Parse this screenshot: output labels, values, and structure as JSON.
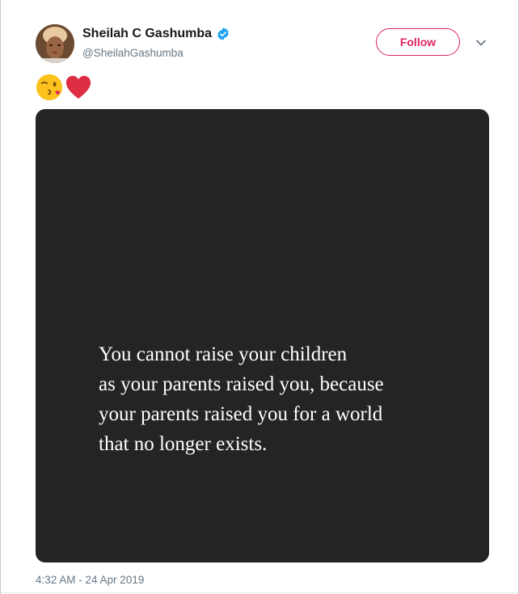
{
  "author": {
    "display_name": "Sheilah C Gashumba",
    "handle": "@SheilahGashumba",
    "verified": true
  },
  "follow_button": {
    "label": "Follow"
  },
  "tweet": {
    "emoji": [
      "winking-kiss-emoji",
      "red-heart-emoji"
    ],
    "media_quote_lines": [
      "You cannot raise your children",
      "as your parents raised you, because",
      "your parents raised you for a world",
      "that no longer exists."
    ],
    "timestamp": "4:32 AM - 24 Apr 2019"
  },
  "colors": {
    "follow_accent": "#e0245e",
    "verified_blue": "#1da1f2",
    "media_background": "#252324",
    "secondary_text": "#657786"
  }
}
